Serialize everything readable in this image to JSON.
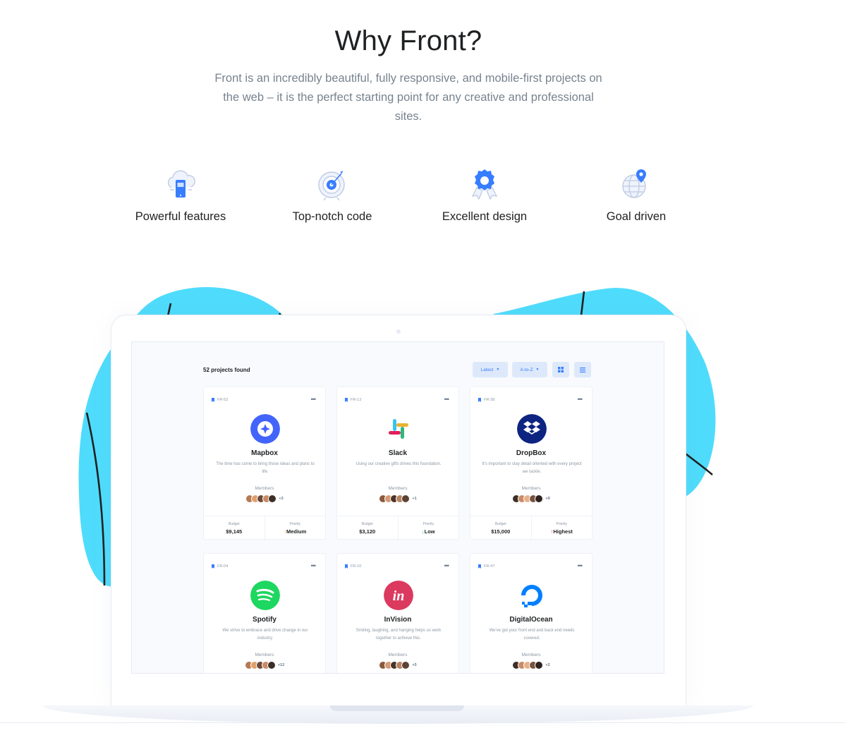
{
  "header": {
    "title": "Why Front?",
    "subtitle": "Front is an incredibly beautiful, fully responsive, and mobile-first projects on the web – it is the perfect starting point for any creative and professional sites."
  },
  "features": [
    {
      "label": "Powerful features",
      "icon": "cloud-phone-icon"
    },
    {
      "label": "Top-notch code",
      "icon": "target-icon"
    },
    {
      "label": "Excellent design",
      "icon": "award-badge-icon"
    },
    {
      "label": "Goal driven",
      "icon": "globe-pin-icon"
    }
  ],
  "colors": {
    "accent": "#377dff",
    "blob": "#4fdcfc",
    "heading": "#1e2022",
    "muted": "#77838f"
  },
  "dashboard": {
    "count_text": "52 projects found",
    "sort_label": "Latest",
    "order_label": "A-to-Z",
    "grid_view_icon": "grid-icon",
    "list_view_icon": "list-icon",
    "members_label": "Members",
    "budget_label": "Budget",
    "priority_label": "Priority",
    "cards": [
      {
        "tag": "FR-52",
        "name": "Mapbox",
        "desc": "The time has come to bring those ideas and plans to life.",
        "members_extra": "+3",
        "budget": "$9,145",
        "priority": "Medium",
        "priority_icon": "arrow-up-icon",
        "logo_color": "#4264fb"
      },
      {
        "tag": "FR-13",
        "name": "Slack",
        "desc": "Using our creative gifts drives this foundation.",
        "members_extra": "+1",
        "budget": "$3,120",
        "priority": "Low",
        "priority_icon": "arrow-down-icon",
        "logo_color": "#ffffff"
      },
      {
        "tag": "FR-38",
        "name": "DropBox",
        "desc": "It's important to stay detail oriented with every project we tackle.",
        "members_extra": "+9",
        "budget": "$15,000",
        "priority": "Highest",
        "priority_icon": "arrow-up-icon",
        "logo_color": "#0d2481"
      },
      {
        "tag": "FR-04",
        "name": "Spotify",
        "desc": "We strive to embrace and drive change in our industry.",
        "members_extra": "+12",
        "logo_color": "#1ed760"
      },
      {
        "tag": "FR-10",
        "name": "InVision",
        "desc": "Smiling, laughing, and hanging helps us work together to achieve this.",
        "members_extra": "+5",
        "logo_color": "#dc395f"
      },
      {
        "tag": "FR-47",
        "name": "DigitalOcean",
        "desc": "We've got your front end and back end needs covered.",
        "members_extra": "+2",
        "logo_color": "#0080ff"
      }
    ]
  }
}
